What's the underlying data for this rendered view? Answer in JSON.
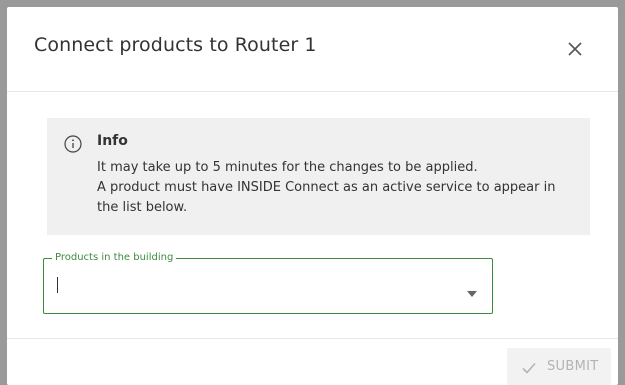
{
  "dialog": {
    "title": "Connect products to Router 1",
    "close_icon": "close-icon"
  },
  "info": {
    "icon": "info-icon",
    "title": "Info",
    "lines": [
      "It may take up to 5 minutes for the changes to be applied.",
      "A product must have INSIDE Connect as an active service to appear in",
      "the list below."
    ]
  },
  "products_field": {
    "label": "Products in the building",
    "value": "",
    "arrow_icon": "dropdown-arrow-icon"
  },
  "footer": {
    "submit_label": "SUBMIT",
    "submit_icon": "check-icon",
    "submit_enabled": false
  },
  "colors": {
    "accent": "#3d8b3d",
    "info_bg": "#f0f0f0",
    "disabled_text": "#b3b3b3",
    "overlay": "#9a9a9a"
  }
}
